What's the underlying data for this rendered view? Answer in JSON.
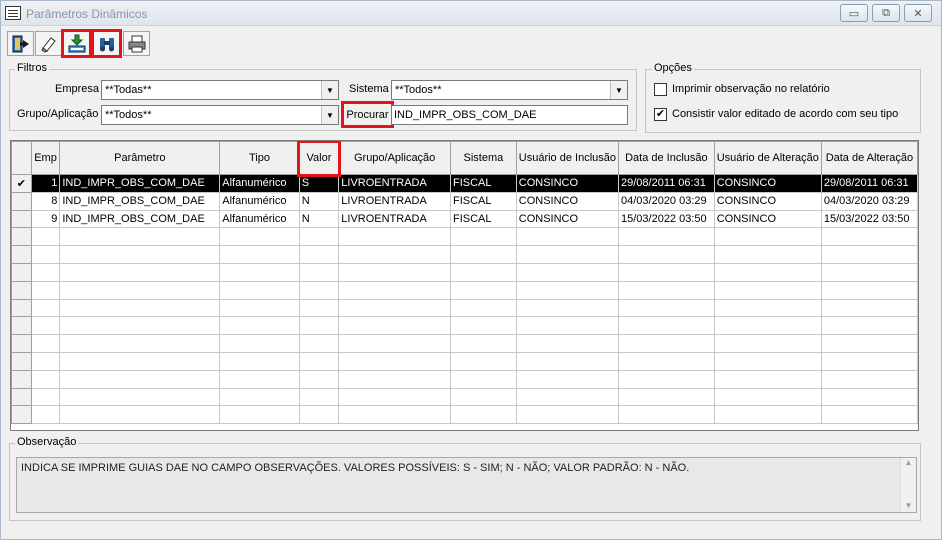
{
  "window": {
    "title": "Parâmetros Dinâmicos",
    "controls": {
      "minimize": "▭",
      "restore": "⧉",
      "close": "✕"
    }
  },
  "toolbar": {
    "buttons": [
      {
        "name": "exit-door-icon",
        "label": "Sair"
      },
      {
        "name": "eraser-icon",
        "label": "Limpar"
      },
      {
        "name": "save-download-icon",
        "label": "Salvar",
        "highlighted": true
      },
      {
        "name": "binoculars-icon",
        "label": "Procurar",
        "highlighted": true
      },
      {
        "name": "printer-icon",
        "label": "Imprimir"
      }
    ]
  },
  "filters": {
    "legend": "Filtros",
    "empresa_label": "Empresa",
    "empresa_value": "**Todas**",
    "sistema_label": "Sistema",
    "sistema_value": "**Todos**",
    "grupo_label": "Grupo/Aplicação",
    "grupo_value": "**Todos**",
    "procurar_label": "Procurar",
    "procurar_value": "IND_IMPR_OBS_COM_DAE"
  },
  "options": {
    "legend": "Opções",
    "imprimir_label": "Imprimir observação no relatório",
    "imprimir_checked": false,
    "consistir_label": "Consistir valor editado de acordo com seu tipo",
    "consistir_checked": true
  },
  "grid": {
    "columns": {
      "emp": "Emp",
      "parametro": "Parâmetro",
      "tipo": "Tipo",
      "valor": "Valor",
      "grupo": "Grupo/Aplicação",
      "sistema": "Sistema",
      "usuario_inclusao": "Usuário de Inclusão",
      "data_inclusao": "Data de Inclusão",
      "usuario_alteracao": "Usuário de Alteração",
      "data_alteracao": "Data de Alteração"
    },
    "rows": [
      {
        "selected": true,
        "indicator": "✔",
        "emp": "1",
        "parametro": "IND_IMPR_OBS_COM_DAE",
        "tipo": "Alfanumérico",
        "valor": "S",
        "grupo": "LIVROENTRADA",
        "sistema": "FISCAL",
        "usuario_inclusao": "CONSINCO",
        "data_inclusao": "29/08/2011 06:31",
        "usuario_alteracao": "CONSINCO",
        "data_alteracao": "29/08/2011 06:31"
      },
      {
        "selected": false,
        "indicator": "",
        "emp": "8",
        "parametro": "IND_IMPR_OBS_COM_DAE",
        "tipo": "Alfanumérico",
        "valor": "N",
        "grupo": "LIVROENTRADA",
        "sistema": "FISCAL",
        "usuario_inclusao": "CONSINCO",
        "data_inclusao": "04/03/2020 03:29",
        "usuario_alteracao": "CONSINCO",
        "data_alteracao": "04/03/2020 03:29"
      },
      {
        "selected": false,
        "indicator": "",
        "emp": "9",
        "parametro": "IND_IMPR_OBS_COM_DAE",
        "tipo": "Alfanumérico",
        "valor": "N",
        "grupo": "LIVROENTRADA",
        "sistema": "FISCAL",
        "usuario_inclusao": "CONSINCO",
        "data_inclusao": "15/03/2022 03:50",
        "usuario_alteracao": "CONSINCO",
        "data_alteracao": "15/03/2022 03:50"
      }
    ],
    "empty_row_count": 11
  },
  "observacao": {
    "legend": "Observação",
    "text": "INDICA SE IMPRIME GUIAS DAE NO CAMPO OBSERVAÇÕES. VALORES POSSÍVEIS: S - SIM; N - NÃO; VALOR PADRÃO: N - NÃO."
  },
  "colors": {
    "highlight": "#e3141b",
    "selected_row_bg": "#000000",
    "selected_row_fg": "#ffffff"
  }
}
